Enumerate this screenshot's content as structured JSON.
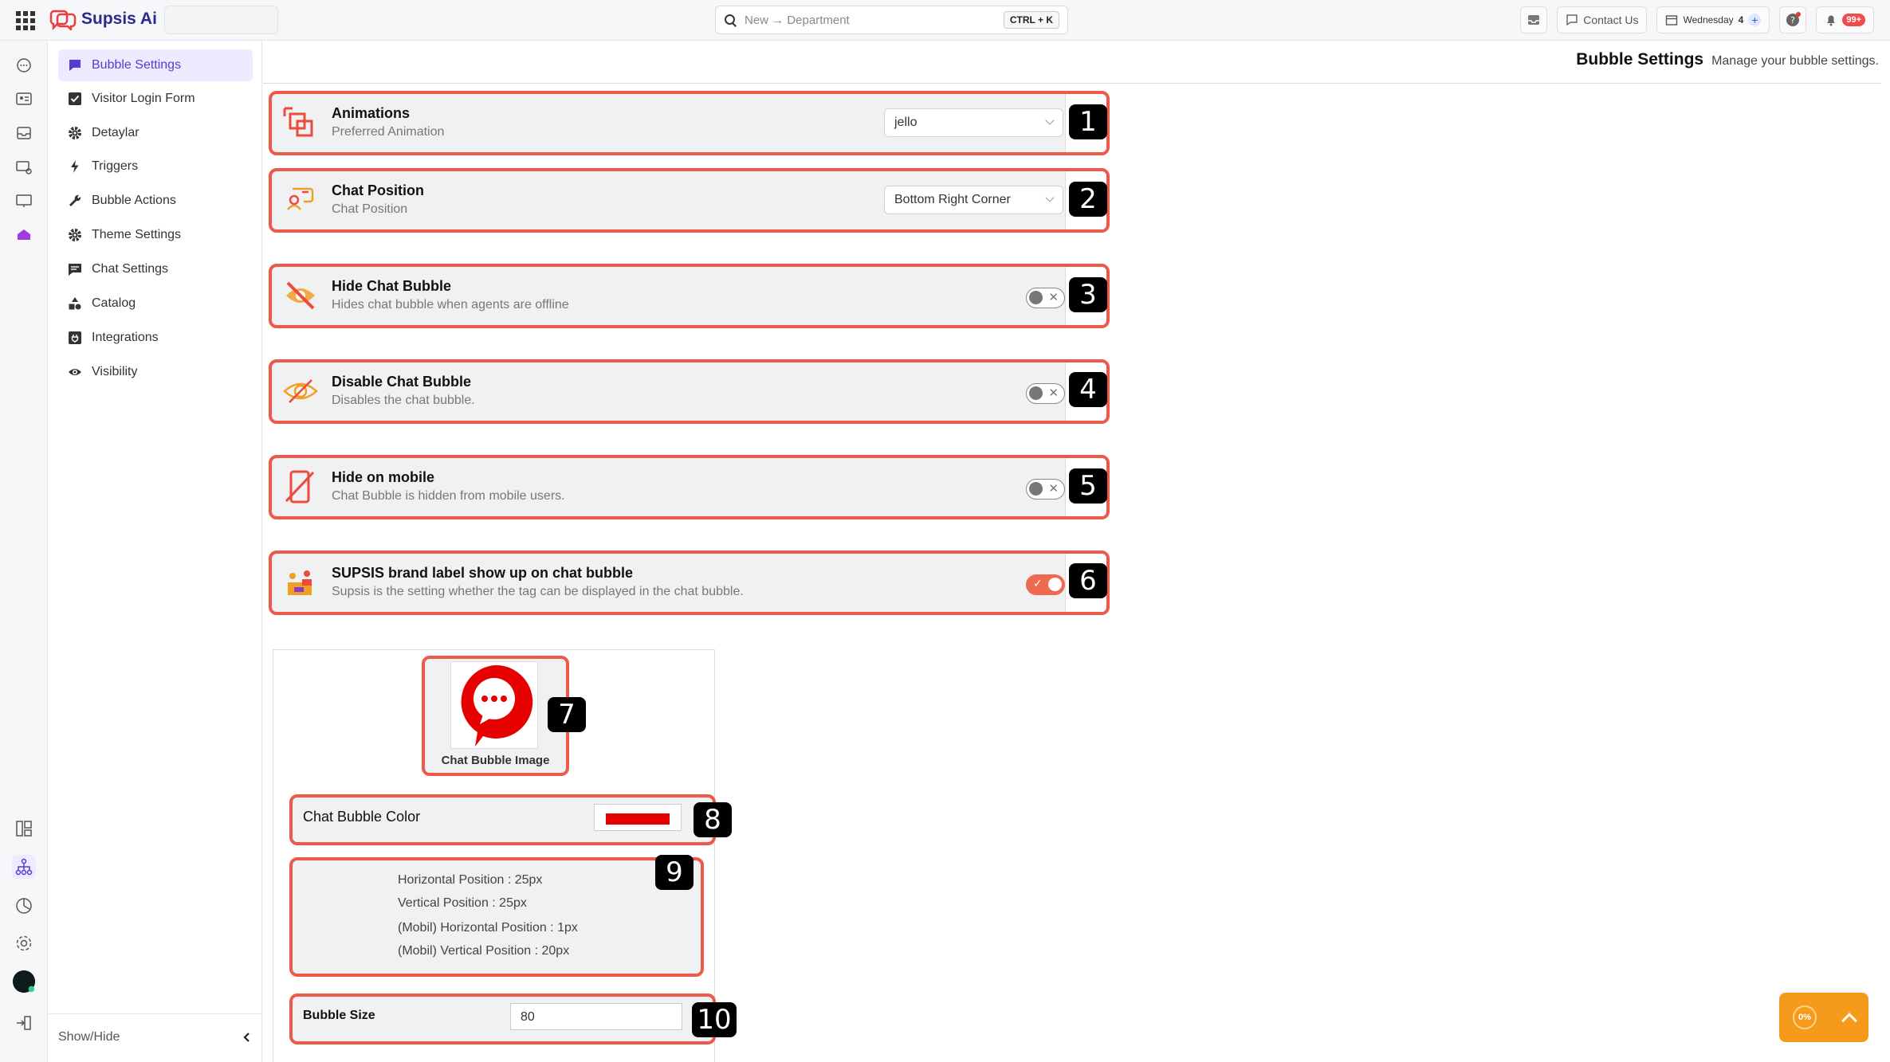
{
  "app": {
    "title": "Supsis Ai"
  },
  "search": {
    "placeholder": "New → Department",
    "shortcut": "CTRL + K"
  },
  "top_right": {
    "contact": "Contact Us",
    "day": "Wednesday",
    "day_num": "4",
    "notif_badge": "99+"
  },
  "sidebar": {
    "items": [
      {
        "label": "Bubble Settings",
        "icon": "chat-square-icon"
      },
      {
        "label": "Visitor Login Form",
        "icon": "checkbox-icon"
      },
      {
        "label": "Detaylar",
        "icon": "gear-icon"
      },
      {
        "label": "Triggers",
        "icon": "bolt-icon"
      },
      {
        "label": "Bubble Actions",
        "icon": "wrench-icon"
      },
      {
        "label": "Theme Settings",
        "icon": "gear-icon"
      },
      {
        "label": "Chat Settings",
        "icon": "chat-lines-icon"
      },
      {
        "label": "Catalog",
        "icon": "shapes-icon"
      },
      {
        "label": "Integrations",
        "icon": "plug-box-icon"
      },
      {
        "label": "Visibility",
        "icon": "eye-icon"
      }
    ],
    "show_hide": "Show/Hide"
  },
  "page": {
    "title": "Bubble Settings",
    "subtitle": "Manage your bubble settings."
  },
  "settings": {
    "animations": {
      "title": "Animations",
      "subtitle": "Preferred Animation",
      "value": "jello",
      "num": "1"
    },
    "chat_position": {
      "title": "Chat Position",
      "subtitle": "Chat Position",
      "value": "Bottom Right Corner",
      "num": "2"
    },
    "hide_bubble": {
      "title": "Hide Chat Bubble",
      "subtitle": "Hides chat bubble when agents are offline",
      "num": "3"
    },
    "disable_bubble": {
      "title": "Disable Chat Bubble",
      "subtitle": "Disables the chat bubble.",
      "num": "4"
    },
    "hide_mobile": {
      "title": "Hide on mobile",
      "subtitle": "Chat Bubble is hidden from mobile users.",
      "num": "5"
    },
    "brand_label": {
      "title": "SUPSIS brand label show up on chat bubble",
      "subtitle": "Supsis is the setting whether the tag can be displayed in the chat bubble.",
      "num": "6"
    },
    "toggle_on_mark": "✓",
    "toggle_off_mark": "✕"
  },
  "bubble": {
    "image_caption": "Chat Bubble Image",
    "image_num": "7",
    "color_label": "Chat Bubble Color",
    "color_value": "#e60000",
    "color_num": "8",
    "positions": [
      "Horizontal Position : 25px",
      "Vertical Position : 25px",
      "(Mobil) Horizontal Position : 1px",
      "(Mobil) Vertical Position : 20px"
    ],
    "positions_num": "9",
    "size_label": "Bubble Size",
    "size_value": "80",
    "size_num": "10"
  },
  "fab": {
    "percent": "0%"
  },
  "colors": {
    "accent": "#ee5a4a",
    "active": "#4d3fd1",
    "fab": "#f59a1a"
  }
}
